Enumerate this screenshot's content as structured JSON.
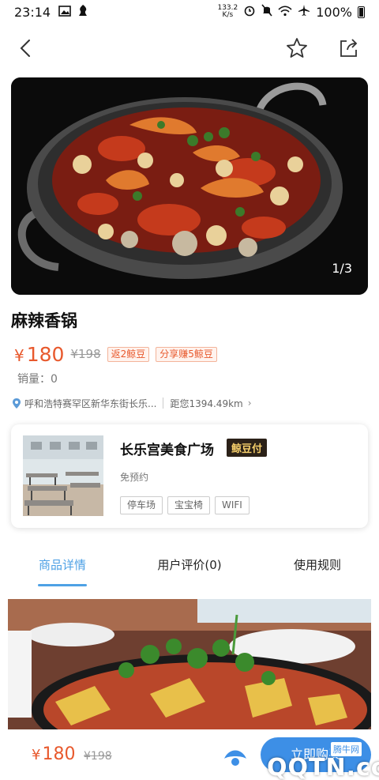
{
  "status_bar": {
    "time": "23:14",
    "net_speed_value": "133.2",
    "net_speed_unit": "K/s",
    "battery": "100%"
  },
  "nav": {
    "back_icon": "chevron-left-icon",
    "favorite_icon": "star-icon",
    "share_icon": "share-icon"
  },
  "gallery": {
    "counter": "1/3"
  },
  "product": {
    "title": "麻辣香锅",
    "price": "180",
    "currency": "¥",
    "original_price": "¥198",
    "tag_rebate": "返2鲸豆",
    "tag_share": "分享赚5鲸豆",
    "sales": "销量：0",
    "address": "呼和浩特赛罕区新华东街长乐...",
    "distance": "距您1394.49km"
  },
  "shop": {
    "name": "长乐宫美食广场",
    "pay_badge": "鲸豆付",
    "subtitle": "免预约",
    "features": [
      "停车场",
      "宝宝椅",
      "WIFI"
    ]
  },
  "tabs": [
    "商品详情",
    "用户评价(0)",
    "使用规则"
  ],
  "bottom_bar": {
    "currency": "¥",
    "price": "180",
    "original_price": "¥198",
    "buy_label": "立即购买"
  },
  "watermark": {
    "text": "QQTN.com",
    "small": "腾牛网"
  },
  "colors": {
    "accent": "#e8592d",
    "tab_active": "#4ea1e5",
    "buy_button": "#3d8fe6"
  }
}
